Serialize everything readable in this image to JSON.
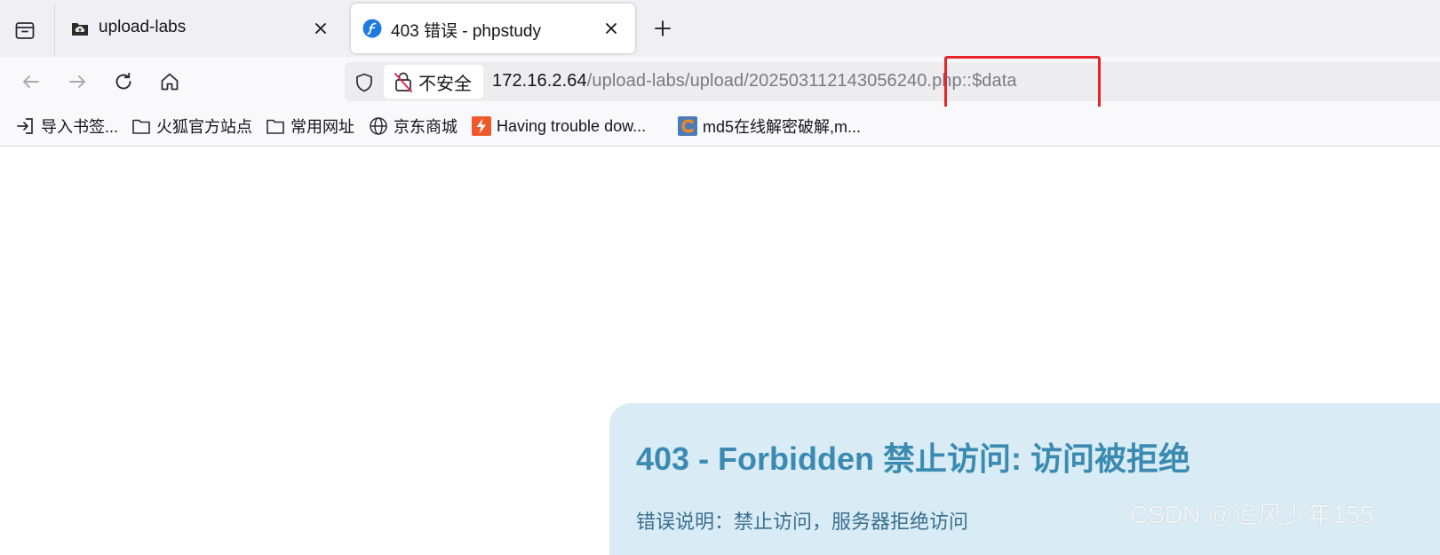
{
  "tabs": [
    {
      "title": "upload-labs",
      "favicon": "folder-cloud-icon"
    },
    {
      "title": "403 错误 - phpstudy",
      "favicon": "flash-icon"
    }
  ],
  "nav": {
    "security_label": "不安全",
    "url_host": "172.16.2.64",
    "url_path": "/upload-labs/upload/202503112143056240.php::$data"
  },
  "bookmarks": [
    {
      "label": "导入书签...",
      "icon": "import-icon"
    },
    {
      "label": "火狐官方站点",
      "icon": "folder-icon"
    },
    {
      "label": "常用网址",
      "icon": "folder-icon"
    },
    {
      "label": "京东商城",
      "icon": "globe-icon"
    },
    {
      "label": "Having trouble dow...",
      "icon": "bolt-icon"
    },
    {
      "label": "md5在线解密破解,m...",
      "icon": "md5-icon"
    }
  ],
  "page": {
    "error_title": "403 - Forbidden 禁止访问: 访问被拒绝",
    "error_desc": "错误说明：禁止访问，服务器拒绝访问"
  },
  "watermark": "CSDN @追风少年155",
  "colors": {
    "highlight": "#e8242a",
    "card_bg": "#d9ecf5",
    "title": "#3b8ab1"
  }
}
